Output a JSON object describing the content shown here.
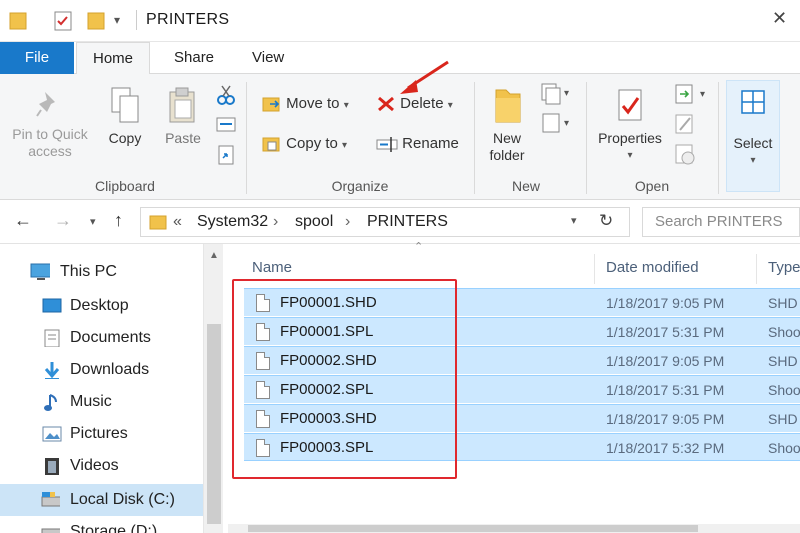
{
  "window": {
    "title": "PRINTERS"
  },
  "tabs": [
    {
      "label": "File"
    },
    {
      "label": "Home"
    },
    {
      "label": "Share"
    },
    {
      "label": "View"
    }
  ],
  "ribbon": {
    "clipboard": {
      "pin_label_1": "Pin to Quick",
      "pin_label_2": "access",
      "copy": "Copy",
      "paste": "Paste",
      "group": "Clipboard"
    },
    "organize": {
      "move_to": "Move to",
      "copy_to": "Copy to",
      "delete": "Delete",
      "rename": "Rename",
      "group": "Organize"
    },
    "new": {
      "new_folder_1": "New",
      "new_folder_2": "folder",
      "group": "New"
    },
    "open": {
      "properties": "Properties",
      "group": "Open"
    },
    "select": {
      "select": "Select"
    }
  },
  "address": {
    "prefix": "«",
    "breadcrumbs": [
      "System32",
      "spool",
      "PRINTERS"
    ],
    "search_placeholder": "Search PRINTERS"
  },
  "navpane": {
    "items": [
      {
        "label": "This PC",
        "icon": "computer-icon"
      },
      {
        "label": "Desktop",
        "icon": "desktop-icon"
      },
      {
        "label": "Documents",
        "icon": "documents-icon"
      },
      {
        "label": "Downloads",
        "icon": "downloads-icon"
      },
      {
        "label": "Music",
        "icon": "music-icon"
      },
      {
        "label": "Pictures",
        "icon": "pictures-icon"
      },
      {
        "label": "Videos",
        "icon": "videos-icon"
      },
      {
        "label": "Local Disk (C:)",
        "icon": "drive-icon",
        "selected": true
      },
      {
        "label": "Storage (D:)",
        "icon": "drive-icon"
      }
    ]
  },
  "filelist": {
    "columns": [
      "Name",
      "Date modified",
      "Type"
    ],
    "rows": [
      {
        "name": "FP00001.SHD",
        "date": "1/18/2017 9:05 PM",
        "type": "SHD"
      },
      {
        "name": "FP00001.SPL",
        "date": "1/18/2017 5:31 PM",
        "type": "Shoo"
      },
      {
        "name": "FP00002.SHD",
        "date": "1/18/2017 9:05 PM",
        "type": "SHD"
      },
      {
        "name": "FP00002.SPL",
        "date": "1/18/2017 5:31 PM",
        "type": "Shoo"
      },
      {
        "name": "FP00003.SHD",
        "date": "1/18/2017 9:05 PM",
        "type": "SHD"
      },
      {
        "name": "FP00003.SPL",
        "date": "1/18/2017 5:32 PM",
        "type": "Shoo"
      }
    ]
  },
  "colors": {
    "accent": "#1979ca",
    "selection": "#cce8ff",
    "highlight_box": "#e0282e",
    "delete_x": "#d9261c"
  }
}
